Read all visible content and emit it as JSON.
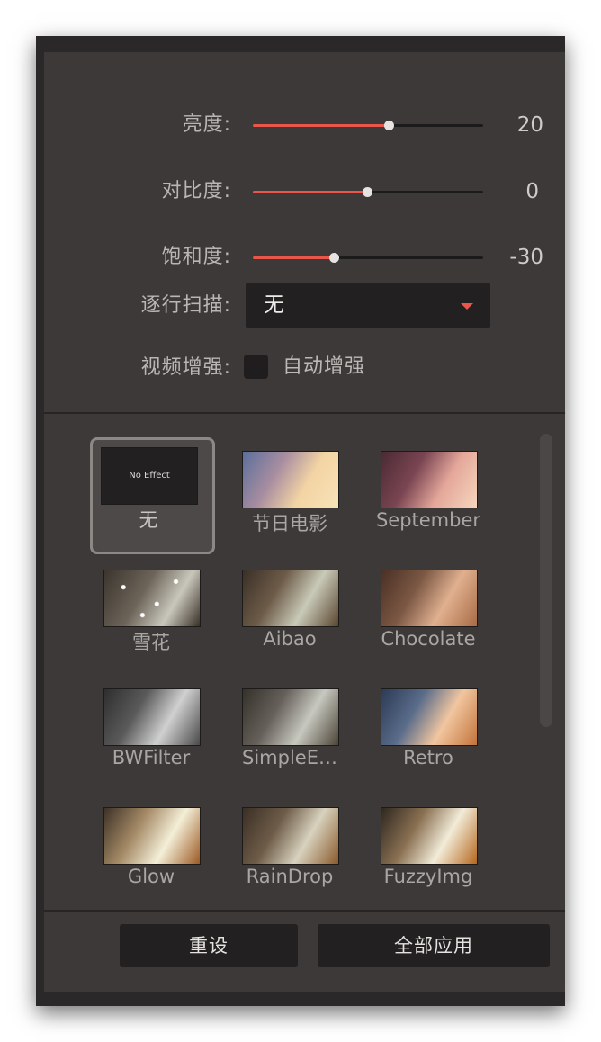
{
  "adjustments": {
    "brightness": {
      "label": "亮度:",
      "value": "20",
      "fraction": 0.59
    },
    "contrast": {
      "label": "对比度:",
      "value": "0",
      "fraction": 0.5
    },
    "saturation": {
      "label": "饱和度:",
      "value": "-30",
      "fraction": 0.35
    }
  },
  "deinterlace": {
    "label": "逐行扫描:",
    "selected": "无"
  },
  "enhance": {
    "label": "视频增强:",
    "checkbox_label": "自动增强",
    "checked": false
  },
  "effects": [
    {
      "name": "无",
      "thumb_text": "No Effect",
      "selected": true
    },
    {
      "name": "节日电影",
      "tint": "festival"
    },
    {
      "name": "September",
      "tint": "september"
    },
    {
      "name": "雪花",
      "tint": "snow"
    },
    {
      "name": "Aibao",
      "tint": "aibao"
    },
    {
      "name": "Chocolate",
      "tint": "chocolate"
    },
    {
      "name": "BWFilter",
      "tint": "bw"
    },
    {
      "name": "SimpleE…",
      "tint": "simple"
    },
    {
      "name": "Retro",
      "tint": "retro"
    },
    {
      "name": "Glow",
      "tint": "glow"
    },
    {
      "name": "RainDrop",
      "tint": "raindrop"
    },
    {
      "name": "FuzzyImg",
      "tint": "fuzzy"
    }
  ],
  "buttons": {
    "reset": "重设",
    "apply_all": "全部应用"
  },
  "colors": {
    "accent": "#e8574a",
    "panel": "#3c3938",
    "field": "#222020"
  }
}
